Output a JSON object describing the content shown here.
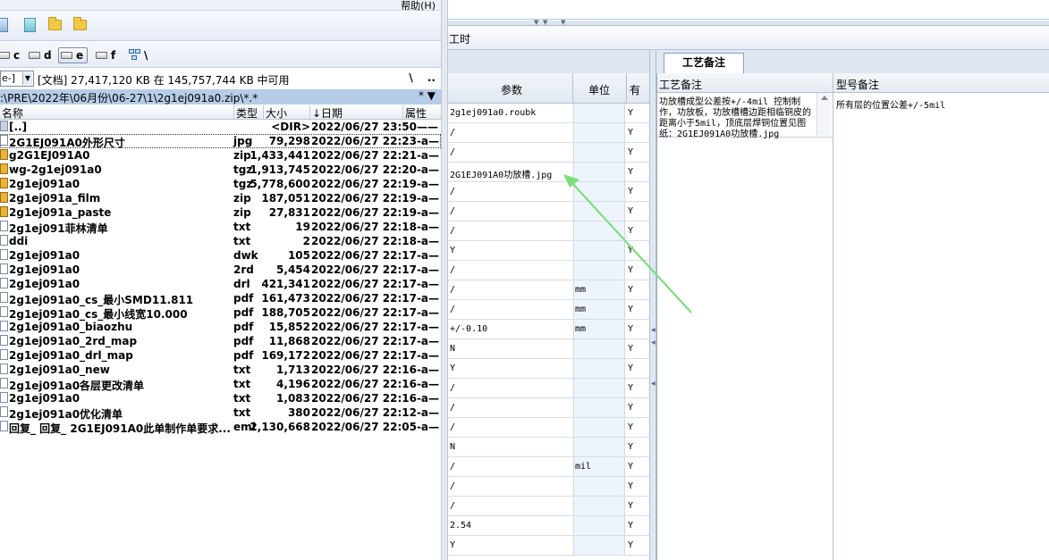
{
  "left_pane": {
    "menu": {
      "help": "帮助(H)"
    },
    "drives": [
      {
        "label": "c",
        "active": false
      },
      {
        "label": "d",
        "active": false
      },
      {
        "label": "e",
        "active": true
      },
      {
        "label": "f",
        "active": false
      },
      {
        "label": "\\",
        "active": false
      }
    ],
    "drive_select": "e-]",
    "free_info": "[文档]  27,417,120 KB 在 145,757,744 KB 中可用",
    "path_buttons": "\\ ..",
    "current_path": ":\\PRE\\2022年\\06月份\\06-27\\1\\2g1ej091a0.zip\\*.*",
    "path_star": "* ▼",
    "columns": {
      "name": "名称",
      "type": "类型",
      "size": "大小",
      "date": "↓日期",
      "attr": "属性"
    },
    "files": [
      {
        "icon": "updir",
        "name": "[..]",
        "type": "",
        "size": "<DIR>",
        "date": "2022/06/27 23:50——",
        "selected": false
      },
      {
        "icon": "doc",
        "name": "2G1EJ091A0外形尺寸",
        "type": "jpg",
        "size": "79,298",
        "date": "2022/06/27 22:23-a—",
        "selected": true
      },
      {
        "icon": "zip",
        "name": "g2G1EJ091A0",
        "type": "zip",
        "size": "1,433,441",
        "date": "2022/06/27 22:21-a—",
        "selected": false
      },
      {
        "icon": "zip",
        "name": "wg-2g1ej091a0",
        "type": "tgz",
        "size": "1,913,745",
        "date": "2022/06/27 22:20-a—",
        "selected": false
      },
      {
        "icon": "zip",
        "name": "2g1ej091a0",
        "type": "tgz",
        "size": "5,778,600",
        "date": "2022/06/27 22:19-a—",
        "selected": false
      },
      {
        "icon": "zip",
        "name": "2g1ej091a_film",
        "type": "zip",
        "size": "187,051",
        "date": "2022/06/27 22:19-a—",
        "selected": false
      },
      {
        "icon": "zip",
        "name": "2g1ej091a_paste",
        "type": "zip",
        "size": "27,831",
        "date": "2022/06/27 22:19-a—",
        "selected": false
      },
      {
        "icon": "doc",
        "name": "2g1ej091菲林清单",
        "type": "txt",
        "size": "19",
        "date": "2022/06/27 22:18-a—",
        "selected": false
      },
      {
        "icon": "doc",
        "name": "ddi",
        "type": "txt",
        "size": "2",
        "date": "2022/06/27 22:18-a—",
        "selected": false
      },
      {
        "icon": "doc",
        "name": "2g1ej091a0",
        "type": "dwk",
        "size": "105",
        "date": "2022/06/27 22:17-a—",
        "selected": false
      },
      {
        "icon": "doc",
        "name": "2g1ej091a0",
        "type": "2rd",
        "size": "5,454",
        "date": "2022/06/27 22:17-a—",
        "selected": false
      },
      {
        "icon": "doc",
        "name": "2g1ej091a0",
        "type": "drl",
        "size": "421,341",
        "date": "2022/06/27 22:17-a—",
        "selected": false
      },
      {
        "icon": "doc",
        "name": "2g1ej091a0_cs_最小SMD11.811",
        "type": "pdf",
        "size": "161,473",
        "date": "2022/06/27 22:17-a—",
        "selected": false
      },
      {
        "icon": "doc",
        "name": "2g1ej091a0_cs_最小线宽10.000",
        "type": "pdf",
        "size": "188,705",
        "date": "2022/06/27 22:17-a—",
        "selected": false
      },
      {
        "icon": "doc",
        "name": "2g1ej091a0_biaozhu",
        "type": "pdf",
        "size": "15,852",
        "date": "2022/06/27 22:17-a—",
        "selected": false
      },
      {
        "icon": "doc",
        "name": "2g1ej091a0_2rd_map",
        "type": "pdf",
        "size": "11,868",
        "date": "2022/06/27 22:17-a—",
        "selected": false
      },
      {
        "icon": "doc",
        "name": "2g1ej091a0_drl_map",
        "type": "pdf",
        "size": "169,172",
        "date": "2022/06/27 22:17-a—",
        "selected": false
      },
      {
        "icon": "doc",
        "name": "2g1ej091a0_new",
        "type": "txt",
        "size": "1,713",
        "date": "2022/06/27 22:16-a—",
        "selected": false
      },
      {
        "icon": "doc",
        "name": "2g1ej091a0各层更改清单",
        "type": "txt",
        "size": "4,196",
        "date": "2022/06/27 22:16-a—",
        "selected": false
      },
      {
        "icon": "doc",
        "name": "2g1ej091a0",
        "type": "txt",
        "size": "1,083",
        "date": "2022/06/27 22:16-a—",
        "selected": false
      },
      {
        "icon": "doc",
        "name": "2g1ej091a0优化清单",
        "type": "txt",
        "size": "380",
        "date": "2022/06/27 22:12-a—",
        "selected": false
      },
      {
        "icon": "doc",
        "name": "回复_ 回复_ 2G1EJ091A0此单制作单要求...",
        "type": "eml",
        "size": "2,130,668",
        "date": "2022/06/27 22:05-a—",
        "selected": false
      }
    ]
  },
  "right_pane": {
    "toolbar_label": "工时",
    "tab_label": "工艺备注",
    "grid_headers": {
      "param": "参数",
      "unit": "单位",
      "flag": "有"
    },
    "grid_rows": [
      {
        "param": "2g1ej091a0.roubk",
        "unit": "",
        "flag": "Y"
      },
      {
        "param": "/",
        "unit": "",
        "flag": "Y"
      },
      {
        "param": "/",
        "unit": "",
        "flag": "Y"
      },
      {
        "param": "2G1EJ091A0功放槽.jpg",
        "unit": "",
        "flag": "Y"
      },
      {
        "param": "/",
        "unit": "",
        "flag": "Y"
      },
      {
        "param": "/",
        "unit": "",
        "flag": "Y"
      },
      {
        "param": "/",
        "unit": "",
        "flag": "Y"
      },
      {
        "param": "Y",
        "unit": "",
        "flag": "Y"
      },
      {
        "param": "/",
        "unit": "",
        "flag": "Y"
      },
      {
        "param": "/",
        "unit": "mm",
        "flag": "Y"
      },
      {
        "param": "/",
        "unit": "mm",
        "flag": "Y"
      },
      {
        "param": "+/-0.10",
        "unit": "mm",
        "flag": "Y"
      },
      {
        "param": "N",
        "unit": "",
        "flag": "Y"
      },
      {
        "param": "Y",
        "unit": "",
        "flag": "Y"
      },
      {
        "param": "/",
        "unit": "",
        "flag": "Y"
      },
      {
        "param": "/",
        "unit": "",
        "flag": "Y"
      },
      {
        "param": "/",
        "unit": "",
        "flag": "Y"
      },
      {
        "param": "N",
        "unit": "",
        "flag": "Y"
      },
      {
        "param": "/",
        "unit": "mil",
        "flag": "Y"
      },
      {
        "param": "/",
        "unit": "",
        "flag": "Y"
      },
      {
        "param": "/",
        "unit": "",
        "flag": "Y"
      },
      {
        "param": "2.54",
        "unit": "",
        "flag": "Y"
      },
      {
        "param": "Y",
        "unit": "",
        "flag": "Y"
      }
    ],
    "notes_headers": {
      "process": "工艺备注",
      "model": "型号备注"
    },
    "process_note": "功放槽成型公差按+/-4mil 控制制作，功放板，功放槽槽边距相临铜皮的距离小于5mil，顶底层焊铜位置见图纸：2G1EJ091A0功放槽.jpg",
    "model_note": "所有层的位置公差+/-5mil",
    "colors": {
      "annotation_arrow": "#7be07b",
      "path_bar": "#b6cde8"
    }
  }
}
